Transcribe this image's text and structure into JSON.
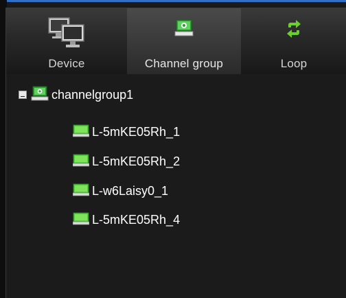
{
  "tabs": [
    {
      "label": "Device",
      "icon": "monitors-icon",
      "active": false
    },
    {
      "label": "Channel group",
      "icon": "channel-group-icon",
      "active": true
    },
    {
      "label": "Loop",
      "icon": "loop-icon",
      "active": false
    }
  ],
  "tree": {
    "group": {
      "label": "channelgroup1",
      "expanded": true
    },
    "channels": [
      {
        "label": "L-5mKE05Rh_1"
      },
      {
        "label": "L-5mKE05Rh_2"
      },
      {
        "label": "L-w6Laisy0_1"
      },
      {
        "label": "L-5mKE05Rh_4"
      }
    ]
  },
  "colors": {
    "accent_blue": "#2f6fc7",
    "group_icon_green": "#3fbf3f",
    "channel_icon_green": "#4fd23a",
    "loop_icon_green": "#6ad12c",
    "text": "#ffffff"
  }
}
